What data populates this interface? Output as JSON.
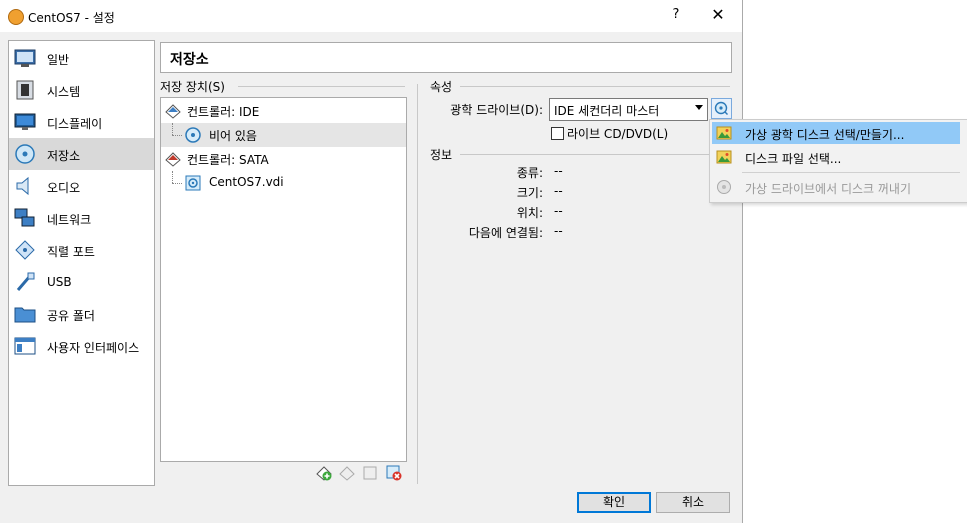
{
  "window": {
    "title": "CentOS7 - 설정",
    "help_label": "?",
    "close_label": "✕"
  },
  "sidebar": {
    "items": [
      {
        "label": "일반",
        "icon": "general-icon"
      },
      {
        "label": "시스템",
        "icon": "system-icon"
      },
      {
        "label": "디스플레이",
        "icon": "display-icon"
      },
      {
        "label": "저장소",
        "icon": "storage-icon",
        "selected": true
      },
      {
        "label": "오디오",
        "icon": "audio-icon"
      },
      {
        "label": "네트워크",
        "icon": "network-icon"
      },
      {
        "label": "직렬 포트",
        "icon": "serial-port-icon"
      },
      {
        "label": "USB",
        "icon": "usb-icon"
      },
      {
        "label": "공유 폴더",
        "icon": "shared-folder-icon"
      },
      {
        "label": "사용자 인터페이스",
        "icon": "user-interface-icon"
      }
    ]
  },
  "page": {
    "title": "저장소"
  },
  "storage": {
    "group_label": "저장 장치(S)",
    "tree": [
      {
        "label": "컨트롤러: IDE",
        "type": "controller"
      },
      {
        "label": "비어 있음",
        "type": "optical-empty",
        "selected": true
      },
      {
        "label": "컨트롤러: SATA",
        "type": "controller"
      },
      {
        "label": "CentOS7.vdi",
        "type": "disk"
      }
    ]
  },
  "attributes": {
    "group_label": "속성",
    "optical_drive_label": "광학 드라이브(D):",
    "optical_drive_value": "IDE 세컨더리 마스터",
    "live_cd_label": "라이브 CD/DVD(L)",
    "live_cd_checked": false
  },
  "info": {
    "group_label": "정보",
    "rows": [
      {
        "label": "종류:",
        "value": "--"
      },
      {
        "label": "크기:",
        "value": "--"
      },
      {
        "label": "위치:",
        "value": "--"
      },
      {
        "label": "다음에 연결됨:",
        "value": "--"
      }
    ]
  },
  "menu": {
    "items": [
      {
        "label": "가상 광학 디스크 선택/만들기...",
        "highlighted": true,
        "enabled": true
      },
      {
        "label": "디스크 파일 선택...",
        "highlighted": false,
        "enabled": true
      },
      {
        "label": "가상 드라이브에서 디스크 꺼내기",
        "highlighted": false,
        "enabled": false
      }
    ]
  },
  "buttons": {
    "ok": "확인",
    "cancel": "취소"
  },
  "colors": {
    "selection": "#d9d9d9",
    "menu_highlight": "#91c9f7",
    "default_button_border": "#0078d7"
  }
}
